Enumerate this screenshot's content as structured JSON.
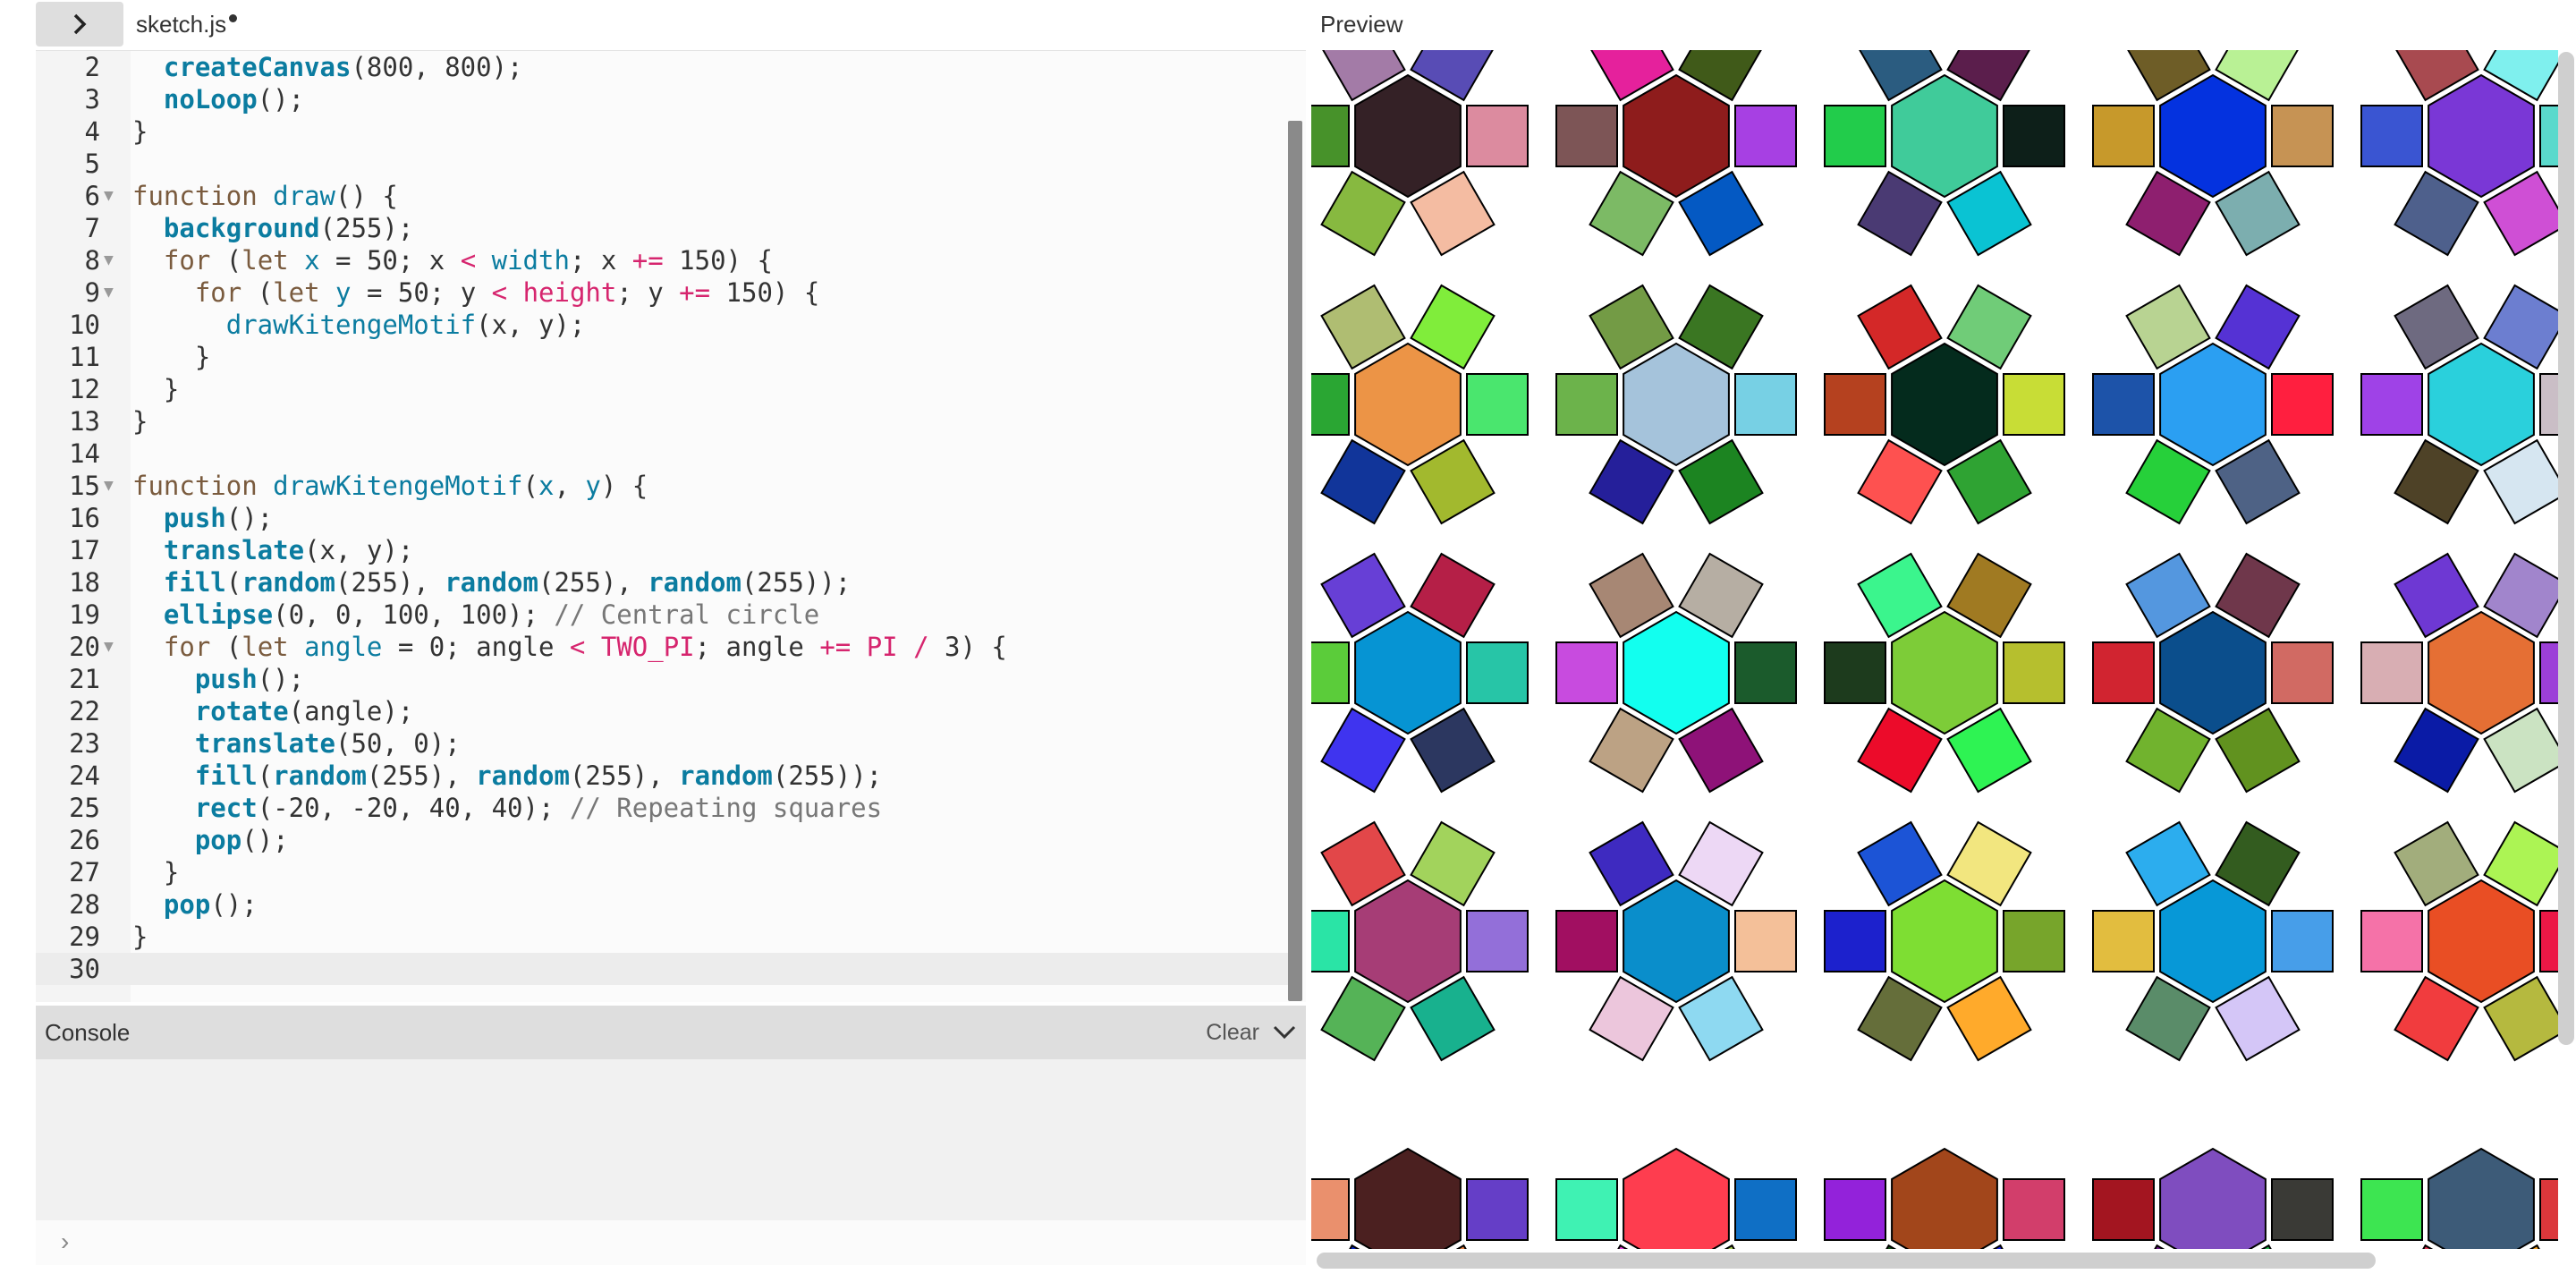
{
  "tab": {
    "filename": "sketch.js"
  },
  "preview": {
    "label": "Preview"
  },
  "console": {
    "title": "Console",
    "clear_label": "Clear",
    "prompt": "›"
  },
  "icons": {
    "expand": "chevron-right-icon",
    "collapse": "chevron-down-icon"
  },
  "code_lines": [
    {
      "n": "2",
      "html": "  <span class='fn'>createCanvas</span>(800, 800);"
    },
    {
      "n": "3",
      "html": "  <span class='fn'>noLoop</span>();"
    },
    {
      "n": "4",
      "html": "}"
    },
    {
      "n": "5",
      "html": ""
    },
    {
      "n": "6",
      "fold": true,
      "html": "<span class='kw'>function</span> <span class='fnname'>draw</span>() {"
    },
    {
      "n": "7",
      "html": "  <span class='fn'>background</span>(255);"
    },
    {
      "n": "8",
      "fold": true,
      "html": "  <span class='kw'>for</span> (<span class='kw'>let</span> <span class='var'>x</span> = 50; x <span class='op'>&lt;</span> <span class='var'>width</span>; x <span class='op'>+=</span> 150) {"
    },
    {
      "n": "9",
      "fold": true,
      "html": "    <span class='kw'>for</span> (<span class='kw'>let</span> <span class='var'>y</span> = 50; y <span class='op'>&lt;</span> <span class='prop'>height</span>; y <span class='op'>+=</span> 150) {"
    },
    {
      "n": "10",
      "html": "      <span class='fnname'>drawKitengeMotif</span>(x, y);"
    },
    {
      "n": "11",
      "html": "    }"
    },
    {
      "n": "12",
      "html": "  }"
    },
    {
      "n": "13",
      "html": "}"
    },
    {
      "n": "14",
      "html": ""
    },
    {
      "n": "15",
      "fold": true,
      "html": "<span class='kw'>function</span> <span class='fnname'>drawKitengeMotif</span>(<span class='var'>x</span>, <span class='var'>y</span>) {"
    },
    {
      "n": "16",
      "html": "  <span class='fn'>push</span>();"
    },
    {
      "n": "17",
      "html": "  <span class='fn'>translate</span>(x, y);"
    },
    {
      "n": "18",
      "html": "  <span class='fn'>fill</span>(<span class='fn'>random</span>(255), <span class='fn'>random</span>(255), <span class='fn'>random</span>(255));"
    },
    {
      "n": "19",
      "html": "  <span class='fn'>ellipse</span>(0, 0, 100, 100); <span class='cmt'>// Central circle</span>"
    },
    {
      "n": "20",
      "fold": true,
      "html": "  <span class='kw'>for</span> (<span class='kw'>let</span> <span class='var'>angle</span> = 0; angle <span class='op'>&lt;</span> <span class='const'>TWO_PI</span>; angle <span class='op'>+=</span> <span class='const'>PI</span> <span class='op'>/</span> 3) {"
    },
    {
      "n": "21",
      "html": "    <span class='fn'>push</span>();"
    },
    {
      "n": "22",
      "html": "    <span class='fn'>rotate</span>(angle);"
    },
    {
      "n": "23",
      "html": "    <span class='fn'>translate</span>(50, 0);"
    },
    {
      "n": "24",
      "html": "    <span class='fn'>fill</span>(<span class='fn'>random</span>(255), <span class='fn'>random</span>(255), <span class='fn'>random</span>(255));"
    },
    {
      "n": "25",
      "html": "    <span class='fn'>rect</span>(-20, -20, 40, 40); <span class='cmt'>// Repeating squares</span>"
    },
    {
      "n": "26",
      "html": "    <span class='fn'>pop</span>();"
    },
    {
      "n": "27",
      "html": "  }"
    },
    {
      "n": "28",
      "html": "  <span class='fn'>pop</span>();"
    },
    {
      "n": "29",
      "html": "}"
    },
    {
      "n": "30",
      "active": true,
      "html": ""
    }
  ],
  "motif_colors": [
    [
      "#342126",
      "#dc8b9f",
      "#f4bca2",
      "#87b940",
      "#47922a",
      "#a37ba7",
      "#584cb5"
    ],
    [
      "#8e1c1c",
      "#a740e3",
      "#0459c3",
      "#7cba65",
      "#7d5556",
      "#e5219c",
      "#405a19"
    ],
    [
      "#40cb9a",
      "#0d1f19",
      "#0ac3d3",
      "#4a3a73",
      "#22cc4b",
      "#2b5c80",
      "#5b1e4c"
    ],
    [
      "#0432df",
      "#c69354",
      "#7caeaf",
      "#8e1f6f",
      "#c7992b",
      "#6e5d27",
      "#b9f195"
    ],
    [
      "#7a37d6",
      "#5ad9cc",
      "#cf4fd5",
      "#4e608c",
      "#3a55d2",
      "#a84a50",
      "#7ff0ee"
    ],
    [
      "#ec9446",
      "#4ae66e",
      "#a2b92e",
      "#11359a",
      "#2aa633",
      "#afbd72",
      "#80ed3b"
    ],
    [
      "#a5c3db",
      "#77d0e4",
      "#1c8421",
      "#251f9a",
      "#6cb34b",
      "#739b45",
      "#3a7622"
    ],
    [
      "#042b1d",
      "#c8dd36",
      "#2fa333",
      "#fe5150",
      "#b5411f",
      "#d42828",
      "#70cc78"
    ],
    [
      "#2b9ff2",
      "#ff1f3f",
      "#4e6285",
      "#26d03a",
      "#1d53a9",
      "#b8d392",
      "#5532d4"
    ],
    [
      "#2ad0dc",
      "#cabec6",
      "#d6e6f1",
      "#4e4227",
      "#9f42e7",
      "#6e6a80",
      "#6c7ed0"
    ],
    [
      "#0694d3",
      "#27c5a7",
      "#2c3760",
      "#3f34ef",
      "#5bcc3a",
      "#673fd6",
      "#b51f47"
    ],
    [
      "#12ffef",
      "#1b5b2c",
      "#8e1278",
      "#bca284",
      "#c84bdf",
      "#a78774",
      "#b6aea3"
    ],
    [
      "#7dcc38",
      "#b6bf2e",
      "#2ef353",
      "#ec0b2a",
      "#1d3b1d",
      "#3bf58d",
      "#a07a22"
    ],
    [
      "#0b4e8c",
      "#d16a63",
      "#61921f",
      "#71b32e",
      "#d12430",
      "#5497df",
      "#6f374b"
    ],
    [
      "#e56f34",
      "#9c3fd8",
      "#cbe3c2",
      "#0a1ba6",
      "#d8aeb3",
      "#6e38d3",
      "#a185cc"
    ],
    [
      "#a63d76",
      "#936fd9",
      "#18b18e",
      "#55b357",
      "#2ae4a6",
      "#e24749",
      "#a2d35c"
    ],
    [
      "#0a8ecb",
      "#f4c099",
      "#8ed9f1",
      "#ecc6dc",
      "#a10f61",
      "#3e2ac0",
      "#edd8f5"
    ],
    [
      "#7ede33",
      "#77a52b",
      "#ffaa2b",
      "#656e3a",
      "#1c21cd",
      "#1c54d6",
      "#f2e67f"
    ],
    [
      "#0798d7",
      "#479ee9",
      "#d4c6f7",
      "#5a8c69",
      "#e2bd3f",
      "#2cadee",
      "#335c1f"
    ],
    [
      "#e94e24",
      "#ec1846",
      "#b5b93f",
      "#f13c3e",
      "#f572a8",
      "#a2ad7c",
      "#acf454"
    ],
    [
      "#4b2020",
      "#653ec7",
      "#e98547",
      "#0424c0",
      "#ea906d"
    ],
    [
      "#fe3d4f",
      "#0f6fc5",
      "#a8ce54",
      "#e642d8",
      "#3ff2b3"
    ],
    [
      "#a2461b",
      "#d23e6b",
      "#1c25df",
      "#0d4f13",
      "#9322da"
    ],
    [
      "#7f4dbf",
      "#3a3a36",
      "#21b54b",
      "#6b1787",
      "#a31520"
    ],
    [
      "#3d5b78",
      "#db373b",
      "#f3a227",
      "#dc3550",
      "#3de551"
    ]
  ]
}
